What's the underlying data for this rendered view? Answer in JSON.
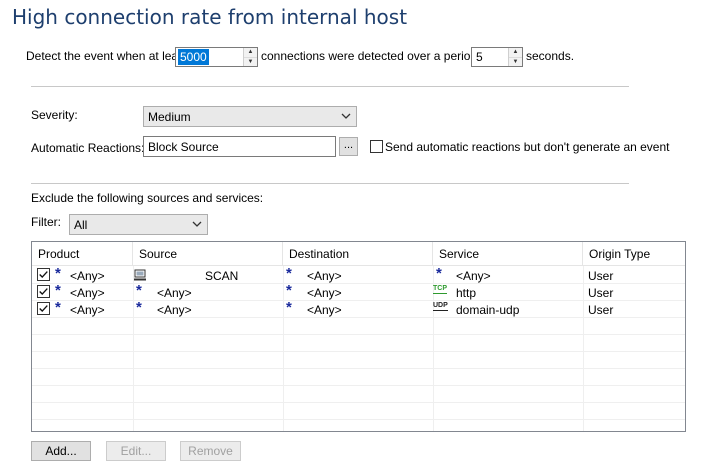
{
  "title": "High connection rate from internal host",
  "detect": {
    "prefix": "Detect the event when at least",
    "connections_value": "5000",
    "middle": "connections were detected over a period of",
    "period_value": "5",
    "suffix": "seconds."
  },
  "severity": {
    "label": "Severity:",
    "value": "Medium"
  },
  "reactions": {
    "label": "Automatic Reactions:",
    "value": "Block Source",
    "browse_label": "...",
    "checkbox_label": "Send automatic reactions but don't generate an event",
    "checkbox_checked": false
  },
  "exclude": {
    "heading": "Exclude the following sources and services:"
  },
  "filter": {
    "label": "Filter:",
    "value": "All"
  },
  "table": {
    "columns": [
      "Product",
      "Source",
      "Destination",
      "Service",
      "Origin Type"
    ],
    "rows": [
      {
        "checked": true,
        "product": "<Any>",
        "source_icon": "computer-icon",
        "source": "SCAN",
        "destination": "<Any>",
        "service_icon": "any-star-icon",
        "service": "<Any>",
        "origin": "User"
      },
      {
        "checked": true,
        "product": "<Any>",
        "source_icon": "any-star-icon",
        "source": "<Any>",
        "destination": "<Any>",
        "service_icon": "tcp-icon",
        "service": "http",
        "origin": "User"
      },
      {
        "checked": true,
        "product": "<Any>",
        "source_icon": "any-star-icon",
        "source": "<Any>",
        "destination": "<Any>",
        "service_icon": "udp-icon",
        "service": "domain-udp",
        "origin": "User"
      }
    ],
    "icon_text": {
      "star": "*",
      "tcp": "TCP",
      "udp": "UDP"
    }
  },
  "buttons": {
    "add": "Add...",
    "edit": "Edit...",
    "remove": "Remove"
  },
  "colors": {
    "title": "#1e3f6e",
    "star": "#1a2a9c",
    "tcp": "#2e9a2e",
    "selection": "#0078d7"
  }
}
